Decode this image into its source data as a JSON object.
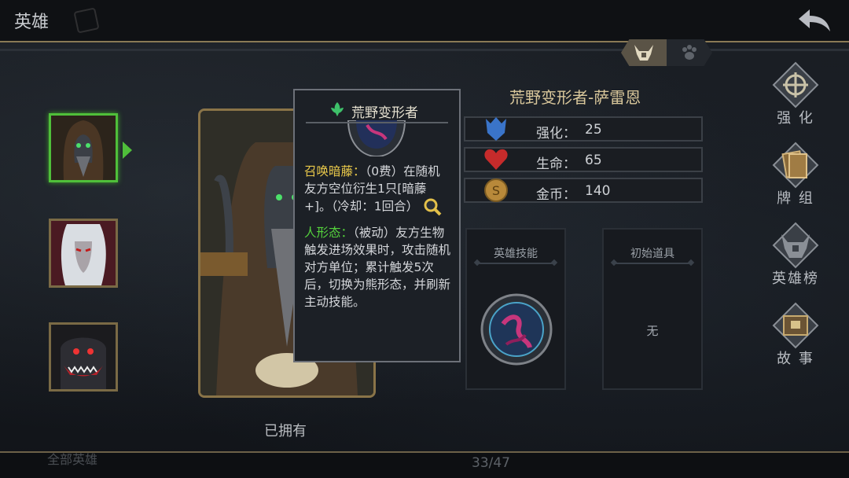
{
  "header": {
    "title": "英雄"
  },
  "tooltip": {
    "title": "荒野变形者",
    "skill1_name": "召唤暗藤：",
    "skill1_desc": "（0费）在随机友方空位衍生1只[暗藤+]。（冷却：1回合）",
    "skill2_name": "人形态：",
    "skill2_desc": "（被动）友方生物触发进场效果时，攻击随机对方单位；累计触发5次后，切换为熊形态，并刷新主动技能。"
  },
  "hero": {
    "name": "荒野变形者-萨雷恩",
    "stats": [
      {
        "label": "强化：",
        "value": "25",
        "icon": "shield-icon",
        "color": "#3a74c9"
      },
      {
        "label": "生命：",
        "value": "65",
        "icon": "heart-icon",
        "color": "#c62b2b"
      },
      {
        "label": "金币：",
        "value": "140",
        "icon": "coin-icon",
        "color": "#b8893a"
      }
    ]
  },
  "card": {
    "status": "已拥有"
  },
  "panels": {
    "skill_title": "英雄技能",
    "item_title": "初始道具",
    "item_value": "无"
  },
  "menu": [
    {
      "label": "强 化",
      "icon": "upgrade-icon"
    },
    {
      "label": "牌 组",
      "icon": "deck-icon"
    },
    {
      "label": "英雄榜",
      "icon": "helmet-icon"
    },
    {
      "label": "故 事",
      "icon": "book-icon"
    }
  ],
  "footer": {
    "page": "33/47",
    "partial_text": "全部英雄"
  }
}
